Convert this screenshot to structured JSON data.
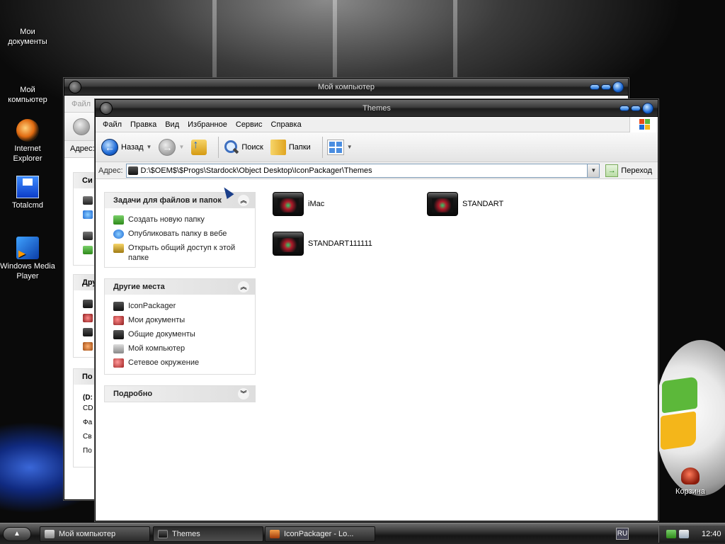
{
  "desktop": {
    "icons": [
      {
        "label": "Мои документы",
        "icon": "my-documents-icon"
      },
      {
        "label": "Мой компьютер",
        "icon": "my-computer-icon"
      },
      {
        "label": "Internet Explorer",
        "icon": "internet-explorer-icon"
      },
      {
        "label": "Totalcmd",
        "icon": "total-commander-icon"
      },
      {
        "label": "Windows Media Player",
        "icon": "windows-media-player-icon"
      },
      {
        "label": "Корзина",
        "icon": "recycle-bin-icon"
      }
    ]
  },
  "back_window": {
    "title": "Мой компьютер",
    "menu_first": "Файл",
    "address_label": "Адрес:",
    "section_labels": [
      "Си",
      "Дру",
      "По"
    ],
    "details": [
      "(D:",
      "CD",
      "Фа",
      "Св",
      "По"
    ]
  },
  "window": {
    "title": "Themes",
    "menu": [
      "Файл",
      "Правка",
      "Вид",
      "Избранное",
      "Сервис",
      "Справка"
    ],
    "toolbar": {
      "back": "Назад",
      "search": "Поиск",
      "folders": "Папки"
    },
    "address": {
      "label": "Адрес:",
      "value": "D:\\$OEM$\\$Progs\\Stardock\\Object Desktop\\IconPackager\\Themes",
      "go": "Переход"
    },
    "taskpane": {
      "tasks": {
        "title": "Задачи для файлов и папок",
        "items": [
          "Создать новую папку",
          "Опубликовать папку в вебе",
          "Открыть общий доступ к этой папке"
        ]
      },
      "places": {
        "title": "Другие места",
        "items": [
          "IconPackager",
          "Мои документы",
          "Общие документы",
          "Мой компьютер",
          "Сетевое окружение"
        ]
      },
      "details": {
        "title": "Подробно"
      }
    },
    "files": [
      "iMac",
      "STANDART",
      "STANDART111111"
    ]
  },
  "taskbar": {
    "tasks": [
      "Мой компьютер",
      "Themes",
      "IconPackager - Lo..."
    ],
    "lang": "RU",
    "clock": "12:40"
  }
}
